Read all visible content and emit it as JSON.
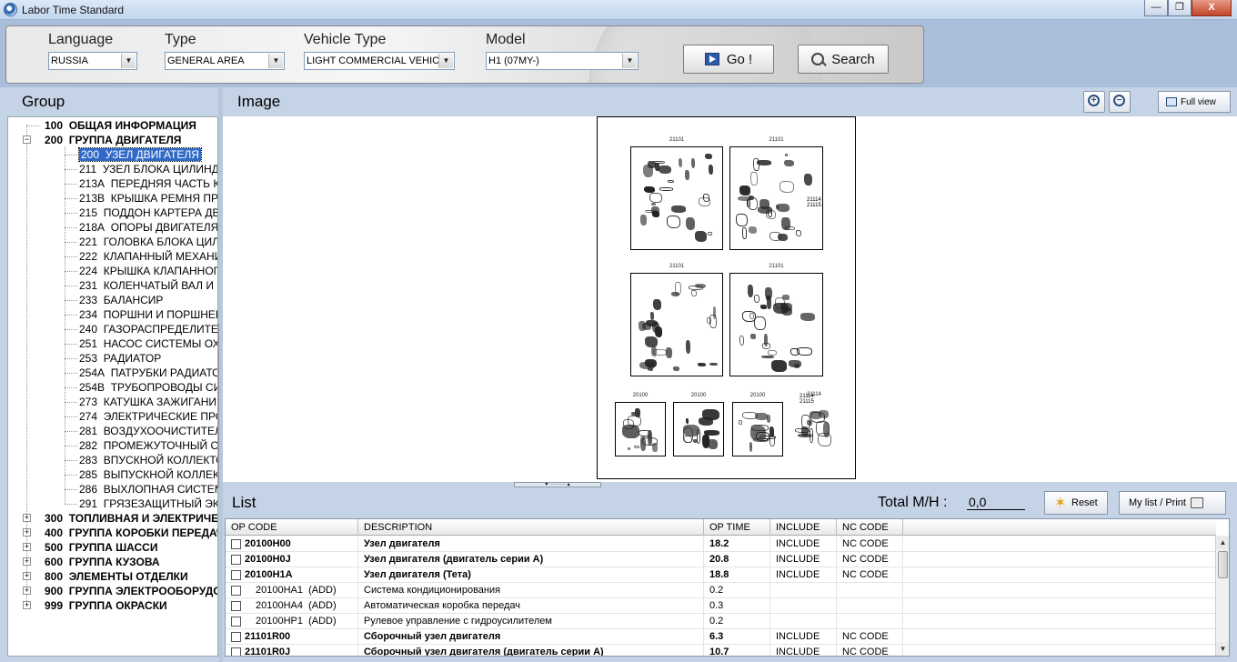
{
  "window": {
    "title": "Labor Time Standard",
    "min": "—",
    "max": "❐",
    "close": "X"
  },
  "filters": {
    "language": {
      "label": "Language",
      "value": "RUSSIA"
    },
    "type": {
      "label": "Type",
      "value": "GENERAL AREA"
    },
    "vehicle_type": {
      "label": "Vehicle Type",
      "value": "LIGHT COMMERCIAL VEHICL"
    },
    "model": {
      "label": "Model",
      "value": "H1 (07MY-)"
    }
  },
  "buttons": {
    "go": "Go !",
    "search": "Search",
    "full_view": "Full view",
    "reset": "Reset",
    "my_list_print": "My list / Print"
  },
  "group": {
    "title": "Group",
    "top_items": [
      {
        "code": "100",
        "name": "ОБЩАЯ ИНФОРМАЦИЯ",
        "expander": ""
      },
      {
        "code": "200",
        "name": "ГРУППА ДВИГАТЕЛЯ",
        "expander": "−"
      }
    ],
    "sub_items": [
      {
        "code": "200",
        "name": "УЗЕЛ ДВИГАТЕЛЯ"
      },
      {
        "code": "211",
        "name": "УЗЕЛ БЛОКА ЦИЛИНДРОВ"
      },
      {
        "code": "213A",
        "name": "ПЕРЕДНЯЯ ЧАСТЬ КАРТЕРА"
      },
      {
        "code": "213B",
        "name": "КРЫШКА РЕМНЯ ПРИВОДА"
      },
      {
        "code": "215",
        "name": "ПОДДОН КАРТЕРА ДВИГАТЕЛЯ"
      },
      {
        "code": "218A",
        "name": "ОПОРЫ ДВИГАТЕЛЯ И ТРАНСМИССИИ"
      },
      {
        "code": "221",
        "name": "ГОЛОВКА БЛОКА ЦИЛИНДРОВ"
      },
      {
        "code": "222",
        "name": "КЛАПАННЫЙ МЕХАНИЗМ"
      },
      {
        "code": "224",
        "name": "КРЫШКА КЛАПАННОГО МЕХАНИЗМА"
      },
      {
        "code": "231",
        "name": "КОЛЕНЧАТЫЙ ВАЛ И МАХОВИК"
      },
      {
        "code": "233",
        "name": "БАЛАНСИР"
      },
      {
        "code": "234",
        "name": "ПОРШНИ И ПОРШНЕВЫЕ КОЛЬЦА"
      },
      {
        "code": "240",
        "name": "ГАЗОРАСПРЕДЕЛИТЕЛЬНЫЙ МЕХАНИЗМ"
      },
      {
        "code": "251",
        "name": "НАСОС СИСТЕМЫ ОХЛАЖДЕНИЯ"
      },
      {
        "code": "253",
        "name": "РАДИАТОР"
      },
      {
        "code": "254A",
        "name": "ПАТРУБКИ РАДИАТОРА"
      },
      {
        "code": "254B",
        "name": "ТРУБОПРОВОДЫ СИСТЕМЫ ОХЛАЖДЕНИЯ"
      },
      {
        "code": "273",
        "name": "КАТУШКА ЗАЖИГАНИЯ"
      },
      {
        "code": "274",
        "name": "ЭЛЕКТРИЧЕСКИЕ ПРОВОДА"
      },
      {
        "code": "281",
        "name": "ВОЗДУХООЧИСТИТЕЛЬ"
      },
      {
        "code": "282",
        "name": "ПРОМЕЖУТОЧНЫЙ ОХЛАДИТЕЛЬ"
      },
      {
        "code": "283",
        "name": "ВПУСКНОЙ КОЛЛЕКТОР"
      },
      {
        "code": "285",
        "name": "ВЫПУСКНОЙ КОЛЛЕКТОР"
      },
      {
        "code": "286",
        "name": "ВЫХЛОПНАЯ СИСТЕМА"
      },
      {
        "code": "291",
        "name": "ГРЯЗЕЗАЩИТНЫЙ ЭКРАН"
      }
    ],
    "bottom_items": [
      {
        "code": "300",
        "name": "ТОПЛИВНАЯ И ЭЛЕКТРИЧЕСКАЯ",
        "expander": "+"
      },
      {
        "code": "400",
        "name": "ГРУППА КОРОБКИ ПЕРЕДАЧ",
        "expander": "+"
      },
      {
        "code": "500",
        "name": "ГРУППА ШАССИ",
        "expander": "+"
      },
      {
        "code": "600",
        "name": "ГРУППА КУЗОВА",
        "expander": "+"
      },
      {
        "code": "800",
        "name": "ЭЛЕМЕНТЫ ОТДЕЛКИ",
        "expander": "+"
      },
      {
        "code": "900",
        "name": "ГРУППА ЭЛЕКТРООБОРУДОВАНИЯ",
        "expander": "+"
      },
      {
        "code": "999",
        "name": "ГРУППА ОКРАСКИ",
        "expander": "+"
      }
    ]
  },
  "image": {
    "title": "Image",
    "zoom_in": "+",
    "zoom_out": "−",
    "diagram_tags": [
      "21101",
      "21101",
      "21101",
      "21101",
      "20100",
      "20100",
      "20100",
      "21114",
      "21114",
      "21115"
    ],
    "splitter": "▾ ········· ▴"
  },
  "list": {
    "title": "List",
    "total_label": "Total M/H :",
    "total_value": "0,0",
    "columns": [
      "OP CODE",
      "DESCRIPTION",
      "OP TIME",
      "INCLUDE",
      "NC CODE"
    ],
    "rows": [
      {
        "op_code": "20100H00",
        "description": "Узел двигателя",
        "op_time": "18.2",
        "include": "INCLUDE",
        "nc_code": "NC CODE",
        "bold": true
      },
      {
        "op_code": "20100H0J",
        "description": "Узел двигателя (двигатель серии A)",
        "op_time": "20.8",
        "include": "INCLUDE",
        "nc_code": "NC CODE",
        "bold": true
      },
      {
        "op_code": "20100H1A",
        "description": "Узел двигателя (Тета)",
        "op_time": "18.8",
        "include": "INCLUDE",
        "nc_code": "NC CODE",
        "bold": true
      },
      {
        "op_code": "20100HA1  (ADD)",
        "description": "Система кондиционирования",
        "op_time": "0.2",
        "include": "",
        "nc_code": "",
        "bold": false
      },
      {
        "op_code": "20100HA4  (ADD)",
        "description": "Автоматическая коробка передач",
        "op_time": "0.3",
        "include": "",
        "nc_code": "",
        "bold": false
      },
      {
        "op_code": "20100HP1  (ADD)",
        "description": "Рулевое управление с гидроусилителем",
        "op_time": "0.2",
        "include": "",
        "nc_code": "",
        "bold": false
      },
      {
        "op_code": "21101R00",
        "description": "Сборочный узел двигателя",
        "op_time": "6.3",
        "include": "INCLUDE",
        "nc_code": "NC CODE",
        "bold": true
      },
      {
        "op_code": "21101R0J",
        "description": "Сборочный узел двигателя (двигатель серии A)",
        "op_time": "10.7",
        "include": "INCLUDE",
        "nc_code": "NC CODE",
        "bold": true
      }
    ]
  },
  "scroll": {
    "up": "▲",
    "down": "▼"
  }
}
